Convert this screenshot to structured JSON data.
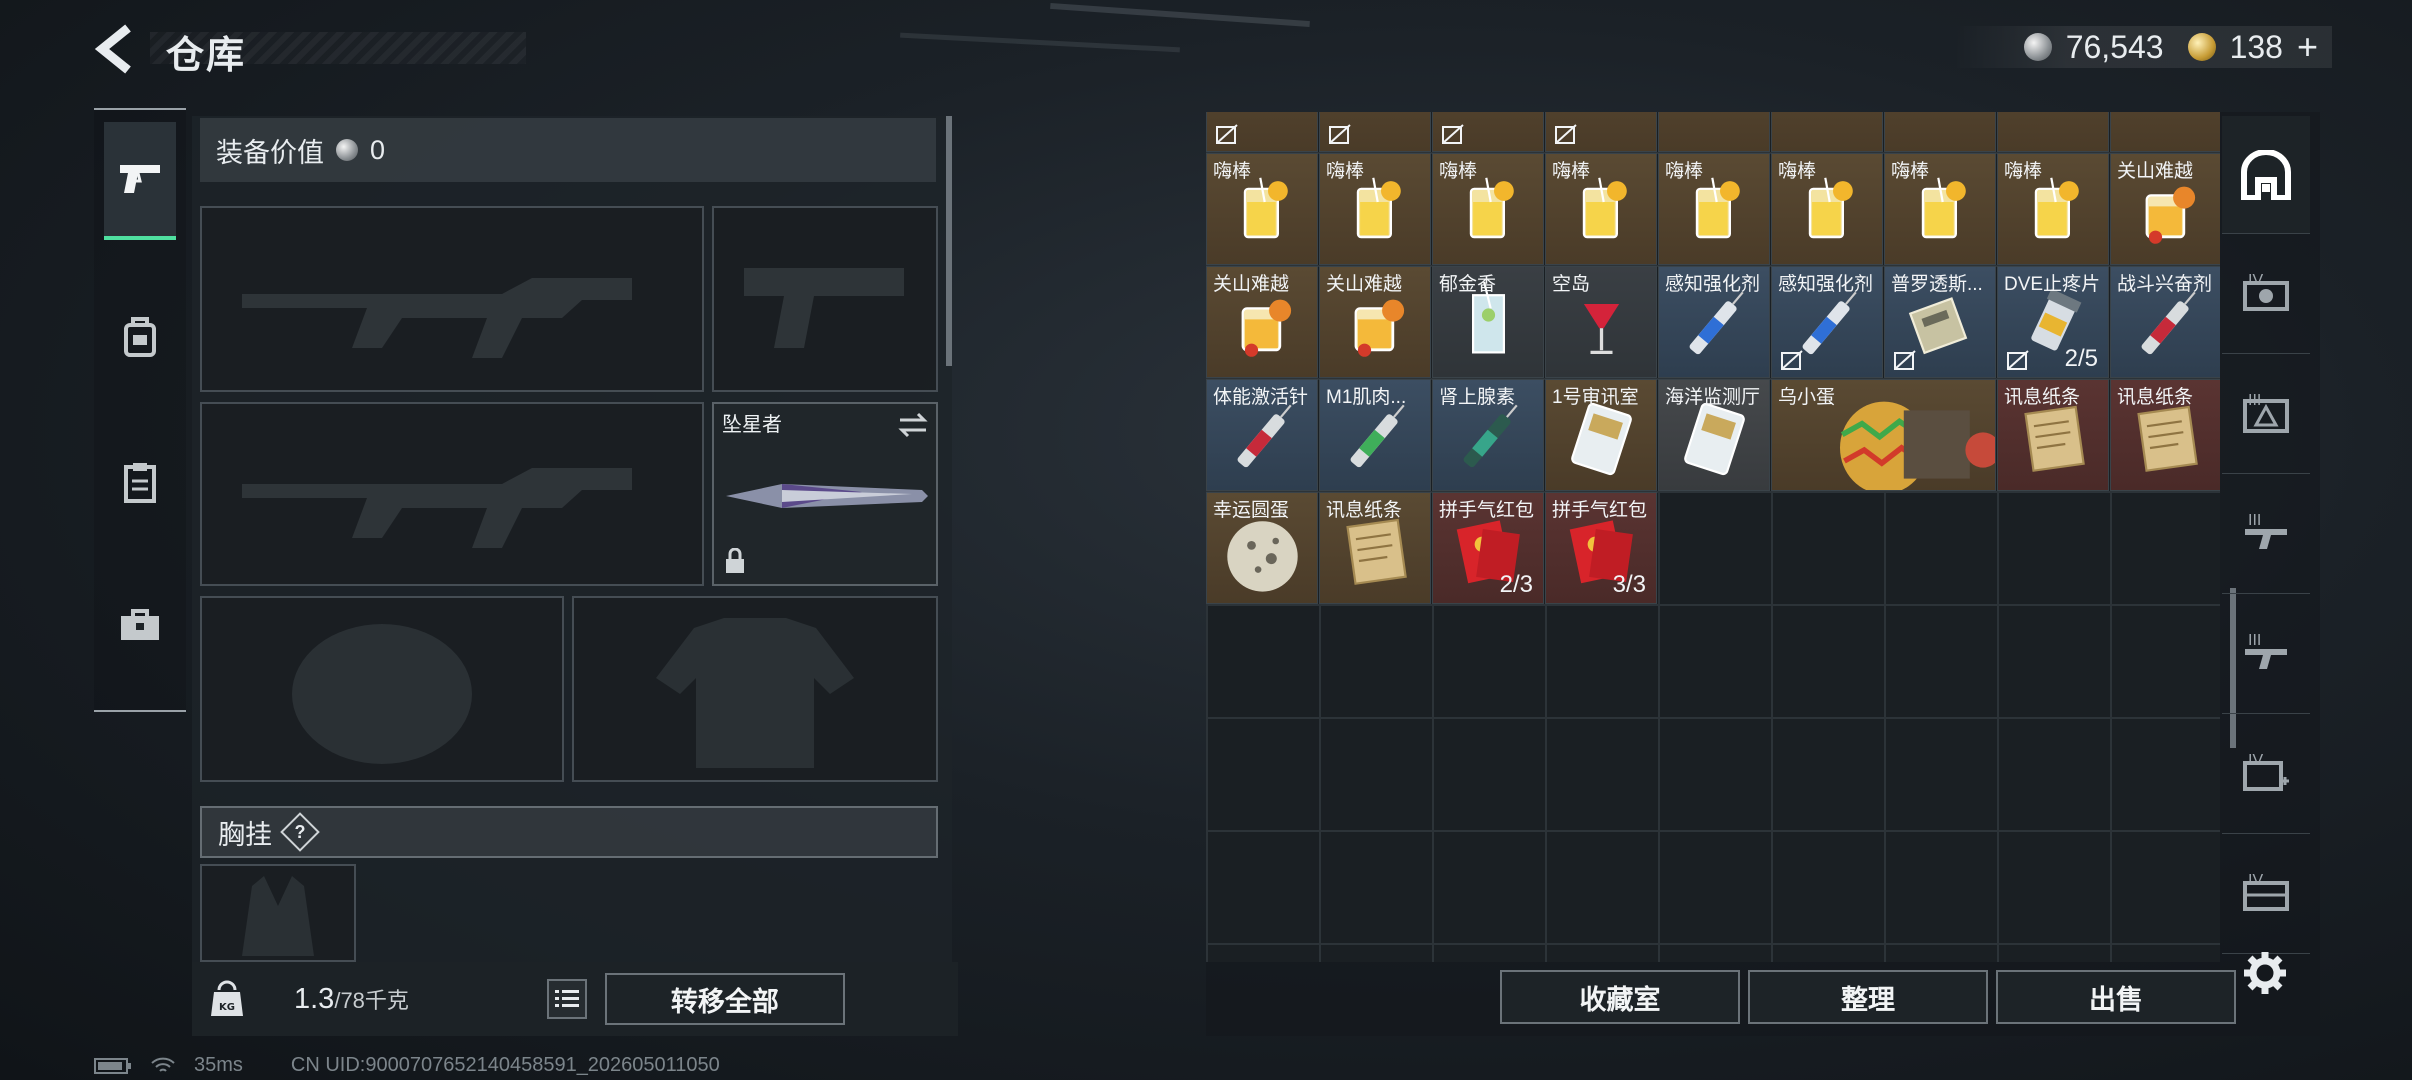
{
  "header": {
    "title": "仓库"
  },
  "currency": {
    "silver": "76,543",
    "gold": "138",
    "gold_plus": "+"
  },
  "equipment": {
    "value_label": "装备价值",
    "value": "0",
    "melee_slot_name": "坠星者",
    "chest_rig_label": "胸挂",
    "help_glyph": "?"
  },
  "footer": {
    "weight_value": "1.3",
    "weight_max": "/78千克",
    "weight_icon_text": "KG",
    "transfer_all": "转移全部"
  },
  "storage": {
    "rows": [
      [
        {
          "name": "",
          "bg": "gold",
          "icon": "knife-icon",
          "count": "",
          "unbound": true
        },
        {
          "name": "",
          "bg": "gold",
          "icon": "knife-icon",
          "count": "",
          "unbound": true
        },
        {
          "name": "",
          "bg": "gold",
          "icon": "knife-icon",
          "count": "",
          "unbound": true
        },
        {
          "name": "",
          "bg": "gold",
          "icon": "knife-icon",
          "count": "",
          "unbound": true
        },
        {
          "name": "",
          "bg": "gold",
          "icon": "item-icon",
          "count": "",
          "unbound": false
        },
        {
          "name": "",
          "bg": "gold",
          "icon": "item-icon",
          "count": "",
          "unbound": false
        },
        {
          "name": "",
          "bg": "gold",
          "icon": "item-icon",
          "count": "",
          "unbound": false
        },
        {
          "name": "",
          "bg": "gold",
          "icon": "drink-icon",
          "count": "",
          "unbound": false
        },
        {
          "name": "",
          "bg": "gold",
          "icon": "drink-icon",
          "count": "",
          "unbound": false
        }
      ],
      [
        {
          "name": "嗨棒",
          "bg": "gold",
          "icon": "lemonade-icon",
          "count": "",
          "unbound": false
        },
        {
          "name": "嗨棒",
          "bg": "gold",
          "icon": "lemonade-icon",
          "count": "",
          "unbound": false
        },
        {
          "name": "嗨棒",
          "bg": "gold",
          "icon": "lemonade-icon",
          "count": "",
          "unbound": false
        },
        {
          "name": "嗨棒",
          "bg": "gold",
          "icon": "lemonade-icon",
          "count": "",
          "unbound": false
        },
        {
          "name": "嗨棒",
          "bg": "gold",
          "icon": "lemonade-icon",
          "count": "",
          "unbound": false
        },
        {
          "name": "嗨棒",
          "bg": "gold",
          "icon": "lemonade-icon",
          "count": "",
          "unbound": false
        },
        {
          "name": "嗨棒",
          "bg": "gold",
          "icon": "lemonade-icon",
          "count": "",
          "unbound": false
        },
        {
          "name": "嗨棒",
          "bg": "gold",
          "icon": "lemonade-icon",
          "count": "",
          "unbound": false
        },
        {
          "name": "关山难越",
          "bg": "gold",
          "icon": "orange-cocktail-icon",
          "count": "",
          "unbound": false
        }
      ],
      [
        {
          "name": "关山难越",
          "bg": "gold",
          "icon": "orange-cocktail-icon",
          "count": "",
          "unbound": false
        },
        {
          "name": "关山难越",
          "bg": "gold",
          "icon": "orange-cocktail-icon",
          "count": "",
          "unbound": false
        },
        {
          "name": "郁金香",
          "bg": "dark",
          "icon": "highball-icon",
          "count": "",
          "unbound": false
        },
        {
          "name": "空岛",
          "bg": "dark",
          "icon": "wine-glass-icon",
          "count": "",
          "unbound": false
        },
        {
          "name": "感知强化剂",
          "bg": "blue",
          "icon": "syringe-blue-icon",
          "count": "",
          "unbound": false
        },
        {
          "name": "感知强化剂",
          "bg": "blue",
          "icon": "syringe-blue-icon",
          "count": "",
          "unbound": true
        },
        {
          "name": "普罗透斯...",
          "bg": "blue",
          "icon": "medkit-icon",
          "count": "",
          "unbound": true
        },
        {
          "name": "DVE止疼片",
          "bg": "blue",
          "icon": "pill-bottle-icon",
          "count": "2/5",
          "unbound": true
        },
        {
          "name": "战斗兴奋剂",
          "bg": "blue",
          "icon": "syringe-red-icon",
          "count": "",
          "unbound": false
        }
      ],
      [
        {
          "name": "体能激活针",
          "bg": "blue",
          "icon": "syringe-red-icon",
          "count": "",
          "unbound": false
        },
        {
          "name": "M1肌肉...",
          "bg": "blue",
          "icon": "syringe-green-icon",
          "count": "",
          "unbound": false
        },
        {
          "name": "肾上腺素",
          "bg": "blue",
          "icon": "syringe-teal-icon",
          "count": "",
          "unbound": false
        },
        {
          "name": "1号审讯室",
          "bg": "gold",
          "icon": "keycard-icon",
          "count": "",
          "unbound": false
        },
        {
          "name": "海洋监测厅",
          "bg": "grey",
          "icon": "keycard-icon",
          "count": "",
          "unbound": false
        },
        {
          "name": "乌小蛋",
          "bg": "gold",
          "icon": "egg-icon",
          "count": "",
          "unbound": false,
          "wide": true
        },
        {
          "name": "讯息纸条",
          "bg": "red",
          "icon": "paper-note-icon",
          "count": "",
          "unbound": false
        },
        {
          "name": "讯息纸条",
          "bg": "red",
          "icon": "paper-note-icon",
          "count": "",
          "unbound": false
        }
      ],
      [
        {
          "name": "幸运圆蛋",
          "bg": "gold",
          "icon": "round-egg-icon",
          "count": "",
          "unbound": false
        },
        {
          "name": "讯息纸条",
          "bg": "gold",
          "icon": "paper-note-icon",
          "count": "",
          "unbound": false
        },
        {
          "name": "拼手气红包",
          "bg": "red",
          "icon": "red-envelope-icon",
          "count": "2/3",
          "unbound": false
        },
        {
          "name": "拼手气红包",
          "bg": "red",
          "icon": "red-envelope-icon",
          "count": "3/3",
          "unbound": false
        }
      ]
    ],
    "buttons": {
      "collection": "收藏室",
      "sort": "整理",
      "sell": "出售"
    }
  },
  "rail": {
    "levels": [
      "IV",
      "III",
      "III",
      "III",
      "IV",
      "IV"
    ]
  },
  "status": {
    "ping": "35ms",
    "uid": "CN UID:9000707652140458591_202605011050"
  }
}
